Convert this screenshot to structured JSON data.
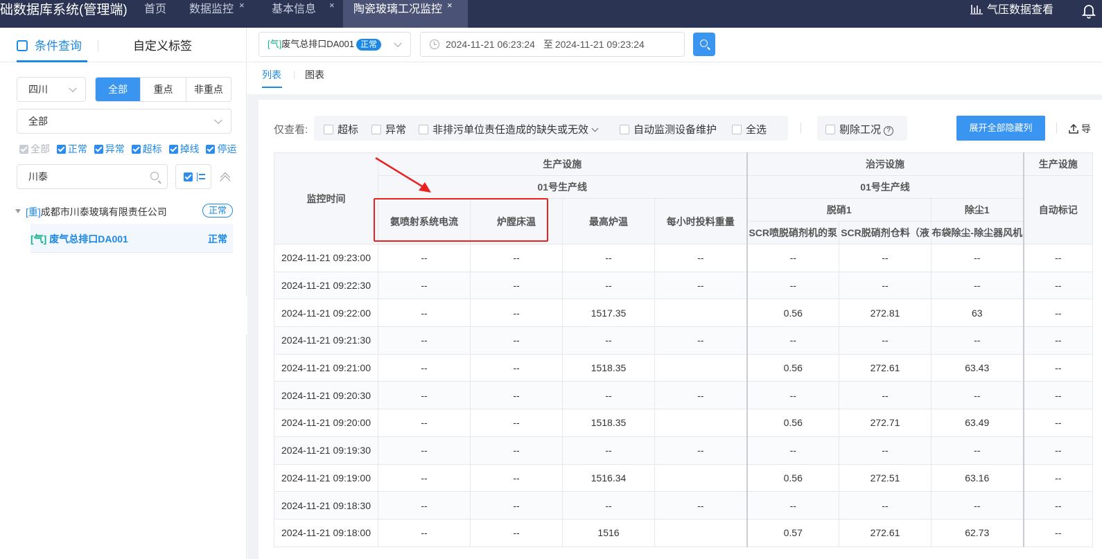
{
  "topbar": {
    "app_title": "础数据库系统(管理端)",
    "tabs": [
      {
        "label": "首页",
        "closable": false,
        "active": false
      },
      {
        "label": "数据监控",
        "closable": true,
        "active": false
      },
      {
        "label": "基本信息",
        "closable": true,
        "active": false
      },
      {
        "label": "陶瓷玻璃工况监控",
        "closable": true,
        "active": true
      }
    ],
    "close_glyph": "×",
    "right_label": "气压数据查看",
    "right_icon": "pressure-icon",
    "bell_icon": "bell-icon"
  },
  "left": {
    "tab_query": "条件查询",
    "tab_custom": "自定义标签",
    "region_select": "四川",
    "segment": [
      "全部",
      "重点",
      "非重点"
    ],
    "type_select": "全部",
    "status_checks": [
      {
        "label": "全部",
        "checked": true,
        "disabled": true
      },
      {
        "label": "正常",
        "checked": true
      },
      {
        "label": "异常",
        "checked": true
      },
      {
        "label": "超标",
        "checked": true
      },
      {
        "label": "掉线",
        "checked": true
      },
      {
        "label": "停运",
        "checked": true
      }
    ],
    "search_value": "川泰",
    "tree": {
      "company_tag": "[重]",
      "company_name": "成都市川泰玻璃有限责任公司",
      "company_status": "正常",
      "outlet_tag": "[气]",
      "outlet_name": "废气总排口DA001",
      "outlet_status": "正常"
    }
  },
  "toolbar": {
    "outlet_tag": "[气]",
    "outlet_name": "废气总排口DA001",
    "outlet_status": "正常",
    "date_start": "2024-11-21 06:23:24",
    "date_sep": "至",
    "date_end": "2024-11-21 09:23:24"
  },
  "view_tabs": {
    "list": "列表",
    "chart": "图表"
  },
  "filters": {
    "label": "仅查看:",
    "items": [
      "超标",
      "异常",
      "非排污单位责任造成的缺失或无效",
      "自动监测设备维护",
      "全选"
    ],
    "exclude": "剔除工况",
    "help": "?",
    "expand_button": "展开全部隐藏列",
    "export": "导"
  },
  "table": {
    "time_header": "监控时间",
    "group_prod": "生产设施",
    "group_treat": "治污设施",
    "group_prod2": "生产设施",
    "line_prod": "01号生产线",
    "line_treat": "01号生产线",
    "sub_denox": "脱硝1",
    "sub_dust": "除尘1",
    "auto_mark": "自动标记",
    "columns": [
      "氨喷射系统电流",
      "炉膛床温",
      "最高炉温",
      "每小时投料重量",
      "SCR喷脱硝剂机的泵",
      "SCR脱硝剂仓料（液",
      "布袋除尘-除尘器风机"
    ],
    "rows": [
      {
        "time": "2024-11-21 09:23:00",
        "v": [
          "--",
          "--",
          "--",
          "--",
          "--",
          "--",
          "--",
          "--"
        ]
      },
      {
        "time": "2024-11-21 09:22:30",
        "v": [
          "--",
          "--",
          "--",
          "--",
          "--",
          "--",
          "--",
          "--"
        ]
      },
      {
        "time": "2024-11-21 09:22:00",
        "v": [
          "--",
          "--",
          "1517.35",
          "",
          "0.56",
          "272.81",
          "63",
          "--"
        ]
      },
      {
        "time": "2024-11-21 09:21:30",
        "v": [
          "--",
          "--",
          "--",
          "--",
          "--",
          "--",
          "--",
          "--"
        ]
      },
      {
        "time": "2024-11-21 09:21:00",
        "v": [
          "--",
          "--",
          "1518.35",
          "",
          "0.56",
          "272.61",
          "63.43",
          "--"
        ]
      },
      {
        "time": "2024-11-21 09:20:30",
        "v": [
          "--",
          "--",
          "--",
          "--",
          "--",
          "--",
          "--",
          "--"
        ]
      },
      {
        "time": "2024-11-21 09:20:00",
        "v": [
          "--",
          "--",
          "1518.35",
          "",
          "0.56",
          "272.71",
          "63.49",
          "--"
        ]
      },
      {
        "time": "2024-11-21 09:19:30",
        "v": [
          "--",
          "--",
          "--",
          "--",
          "--",
          "--",
          "--",
          "--"
        ]
      },
      {
        "time": "2024-11-21 09:19:00",
        "v": [
          "--",
          "--",
          "1516.34",
          "",
          "0.56",
          "272.51",
          "63.16",
          "--"
        ]
      },
      {
        "time": "2024-11-21 09:18:30",
        "v": [
          "--",
          "--",
          "--",
          "--",
          "--",
          "--",
          "--",
          "--"
        ]
      },
      {
        "time": "2024-11-21 09:18:00",
        "v": [
          "--",
          "--",
          "1516",
          "",
          "0.57",
          "272.61",
          "62.73",
          "--"
        ]
      }
    ]
  },
  "annotation_color": "#e8231f",
  "accent": "#1e88e5"
}
